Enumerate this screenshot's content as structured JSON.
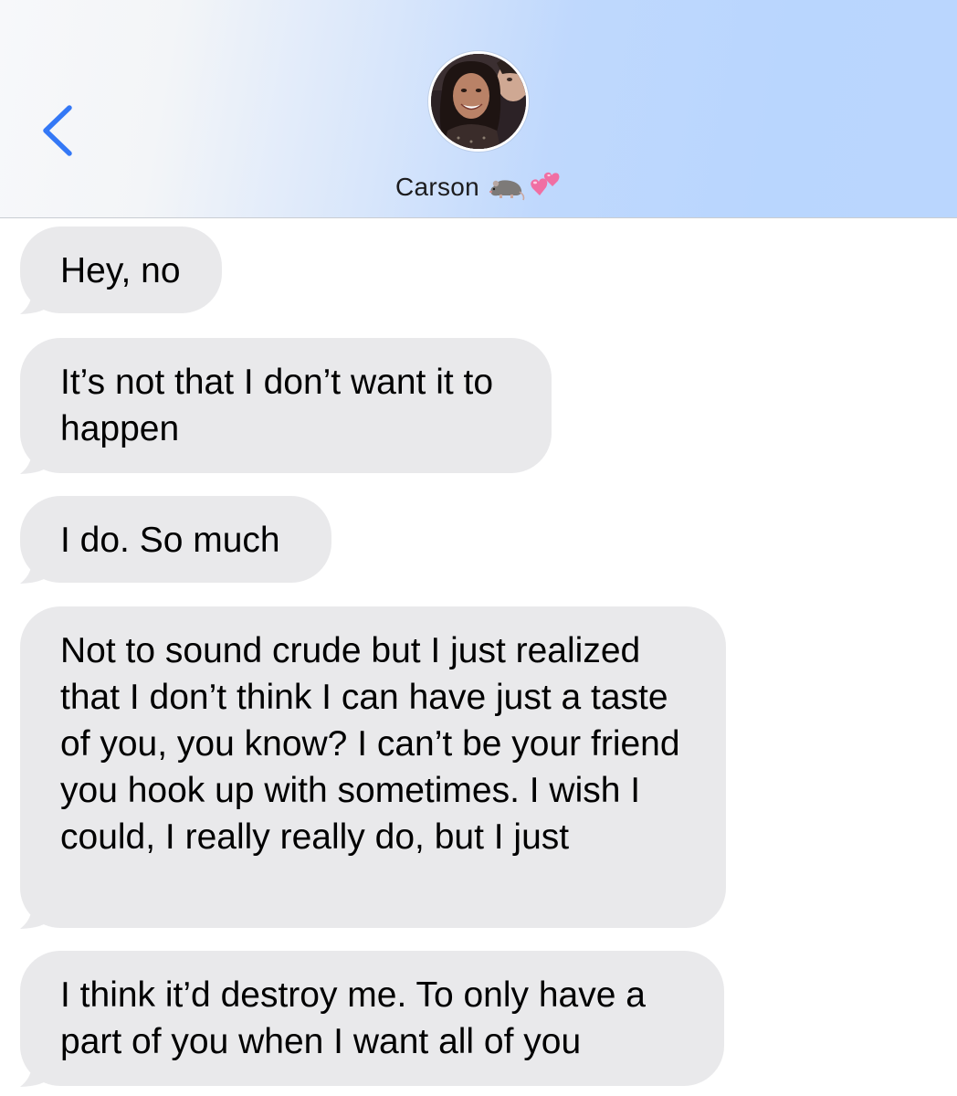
{
  "header": {
    "contact_name": "Carson",
    "contact_emoji": [
      "rat-icon",
      "two-hearts-icon"
    ],
    "back_icon": "chevron-left-icon",
    "accent_color": "#3478f6",
    "gradient_end_color": "#bad6fe"
  },
  "messages": [
    {
      "sender": "incoming",
      "text": "Hey, no"
    },
    {
      "sender": "incoming",
      "text": "It’s not that I don’t want it to happen"
    },
    {
      "sender": "incoming",
      "text": "I do. So much"
    },
    {
      "sender": "incoming",
      "text": "Not to sound crude but I just realized that I don’t think I can have just a taste of you, you know? I can’t be your friend you hook up with sometimes. I wish I could, I really really do, but I just"
    },
    {
      "sender": "incoming",
      "text": "I think it’d destroy me. To only have a part of you when I want all of you"
    }
  ],
  "colors": {
    "incoming_bubble": "#e9e9eb",
    "text": "#000000"
  }
}
